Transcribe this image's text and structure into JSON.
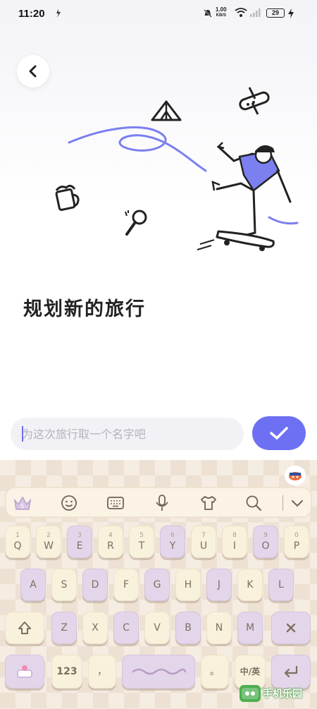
{
  "status_bar": {
    "time": "11:20",
    "net_speed_value": "1.00",
    "net_speed_unit": "KB/S",
    "battery": "29"
  },
  "page": {
    "title": "规划新的旅行"
  },
  "name_input": {
    "value": "",
    "placeholder": "为这次旅行取一个名字吧"
  },
  "keyboard": {
    "row1": [
      {
        "num": "1",
        "letter": "Q"
      },
      {
        "num": "2",
        "letter": "W"
      },
      {
        "num": "3",
        "letter": "E"
      },
      {
        "num": "4",
        "letter": "R"
      },
      {
        "num": "5",
        "letter": "T"
      },
      {
        "num": "6",
        "letter": "Y"
      },
      {
        "num": "7",
        "letter": "U"
      },
      {
        "num": "8",
        "letter": "I"
      },
      {
        "num": "9",
        "letter": "O"
      },
      {
        "num": "0",
        "letter": "P"
      }
    ],
    "row2": [
      "A",
      "S",
      "D",
      "F",
      "G",
      "H",
      "J",
      "K",
      "L"
    ],
    "row3": [
      "Z",
      "X",
      "C",
      "V",
      "B",
      "N",
      "M"
    ],
    "num_key": "123",
    "punct_key": "，",
    "period_key": "。",
    "lang_key": "中/英"
  },
  "watermark": {
    "text": "手机乐园"
  },
  "colors": {
    "accent": "#6e70f3",
    "keyboard_bg": "#f5ece2",
    "key_cream": "#f8f1dc",
    "key_purple": "#e4d6ea"
  }
}
